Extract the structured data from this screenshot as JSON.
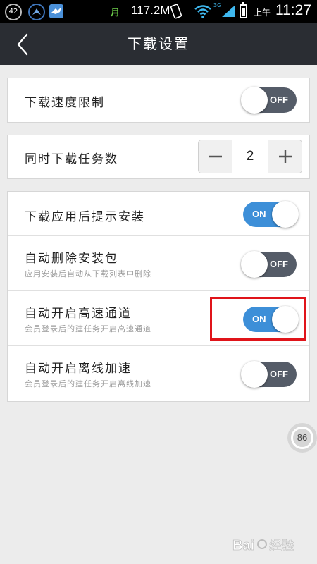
{
  "status_bar": {
    "badge_count": "42",
    "sim_label": "月",
    "net_speed": "117.2M",
    "net_type": "3G",
    "ampm": "上午",
    "time": "11:27"
  },
  "nav": {
    "title": "下载设置"
  },
  "settings": {
    "speed_limit": {
      "label": "下载速度限制",
      "state": "off",
      "toggle_text": "OFF"
    },
    "concurrent_tasks": {
      "label": "同时下载任务数",
      "value": "2"
    },
    "prompt_install": {
      "label": "下载应用后提示安装",
      "state": "on",
      "toggle_text": "ON"
    },
    "auto_delete": {
      "label": "自动删除安装包",
      "sub": "应用安装后自动从下载列表中删除",
      "state": "off",
      "toggle_text": "OFF"
    },
    "high_speed": {
      "label": "自动开启高速通道",
      "sub": "会员登录后的建任务开启高速通道",
      "state": "on",
      "toggle_text": "ON"
    },
    "offline_accel": {
      "label": "自动开启离线加速",
      "sub": "会员登录后的建任务开启离线加速",
      "state": "off",
      "toggle_text": "OFF"
    }
  },
  "float_badge": {
    "value": "86"
  },
  "watermark": {
    "text": "Bai 经验"
  },
  "colors": {
    "nav_bg": "#2a2d33",
    "toggle_on": "#3d8fd8",
    "toggle_off": "#555c68",
    "highlight": "#e0141a"
  }
}
